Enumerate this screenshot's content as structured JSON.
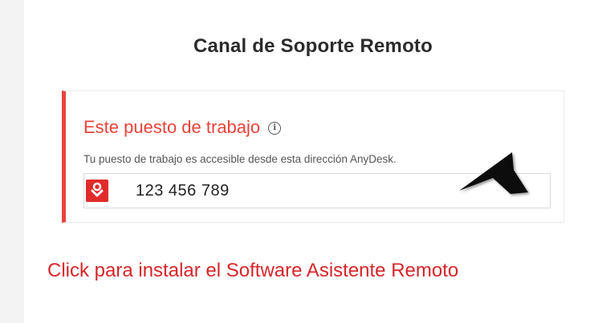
{
  "page": {
    "title": "Canal de Soporte Remoto"
  },
  "card": {
    "heading": "Este puesto de trabajo",
    "info_icon": "ⓘ",
    "description": "Tu puesto de trabajo es accesible desde esta dirección AnyDesk.",
    "address": "123 456 789",
    "brand_icon": "anydesk-logo-icon",
    "pointer_icon": "arrow-pointer-icon"
  },
  "install_link": {
    "label": "Click para instalar el Software Asistente Remoto"
  },
  "colors": {
    "accent_red": "#e8433a",
    "link_red": "#d6262a",
    "badge_red": "#e02b2b",
    "title_text": "#2b2b2b"
  }
}
